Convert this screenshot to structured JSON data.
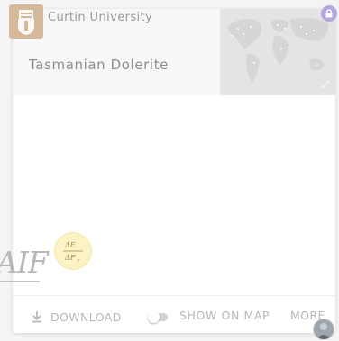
{
  "record": {
    "institution": "Curtin University",
    "title": "Tasmanian Dolerite"
  },
  "preview": {
    "formula_glyph_top": "ΔF",
    "formula_glyph_bottom": "ΔF",
    "formula_sub": "r",
    "logo_glyph": "AIF"
  },
  "footer": {
    "download_label": "DOWNLOAD",
    "show_on_map_label": "SHOW ON MAP",
    "show_on_map_enabled": false,
    "more_label": "MORE"
  },
  "colors": {
    "logo": "#d4b99a",
    "lock_badge": "#b4a5de",
    "formula_bg": "#fbf3c6",
    "text_muted": "#b7b7b7"
  },
  "icons": {
    "download": "download-icon",
    "lock": "lock-icon",
    "expand": "expand-icon",
    "university_logo": "crest-icon"
  }
}
